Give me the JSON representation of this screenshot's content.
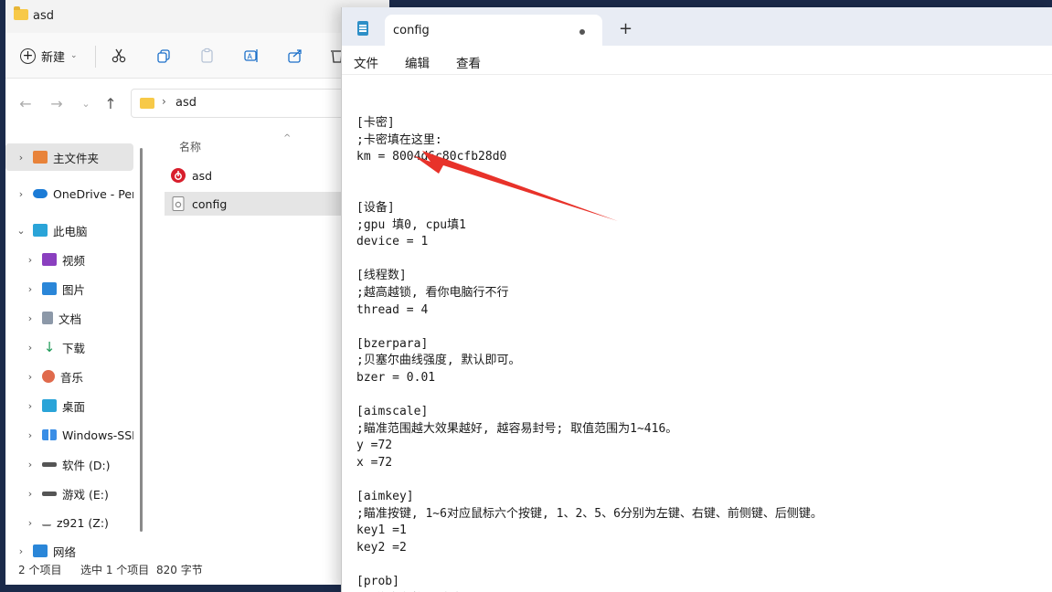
{
  "explorer": {
    "title": "asd",
    "toolbar": {
      "new_label": "新建"
    },
    "address": {
      "path": "asd"
    },
    "nav_items": [
      {
        "label": "主文件夹",
        "icon": "home-icon",
        "color": "#e8833a"
      },
      {
        "label": "OneDrive - Pers",
        "icon": "cloud-icon",
        "color": "#1b7bd6"
      },
      {
        "label": "此电脑",
        "icon": "computer-icon",
        "color": "#2aa4d8"
      },
      {
        "label": "视频",
        "icon": "video-icon",
        "color": "#8a3fbf"
      },
      {
        "label": "图片",
        "icon": "pictures-icon",
        "color": "#2a86d8"
      },
      {
        "label": "文档",
        "icon": "documents-icon",
        "color": "#8c98a8"
      },
      {
        "label": "下载",
        "icon": "download-icon",
        "color": "#1e9a58"
      },
      {
        "label": "音乐",
        "icon": "music-icon",
        "color": "#e06a4c"
      },
      {
        "label": "桌面",
        "icon": "desktop-icon",
        "color": "#2aa4d8"
      },
      {
        "label": "Windows-SSD",
        "icon": "drive-icon",
        "color": "#555555"
      },
      {
        "label": "软件 (D:)",
        "icon": "drive-icon",
        "color": "#555555"
      },
      {
        "label": "游戏 (E:)",
        "icon": "drive-icon",
        "color": "#555555"
      },
      {
        "label": "z921 (Z:)",
        "icon": "network-drive-icon",
        "color": "#888888"
      },
      {
        "label": "网络",
        "icon": "network-icon",
        "color": "#2a86d8"
      }
    ],
    "column_header": "名称",
    "files": [
      {
        "name": "asd",
        "icon": "netease-music-icon",
        "color": "#d81e2c"
      },
      {
        "name": "config",
        "icon": "config-file-icon",
        "color": "#8a8a8a"
      }
    ],
    "status": {
      "item_count": "2 个项目",
      "selection": "选中 1 个项目",
      "size": "820 字节"
    }
  },
  "notepad": {
    "tab_title": "config",
    "new_tab_label": "+",
    "menu": {
      "file": "文件",
      "edit": "编辑",
      "view": "查看"
    },
    "lines": [
      "[卡密]",
      ";卡密填在这里:",
      "km = 8004d6c80cfb28d0",
      "",
      "",
      "[设备]",
      ";gpu 填0, cpu填1",
      "device = 1",
      "",
      "[线程数]",
      ";越高越锁, 看你电脑行不行",
      "thread = 4",
      "",
      "[bzerpara]",
      ";贝塞尔曲线强度, 默认即可。",
      "bzer = 0.01",
      "",
      "[aimscale]",
      ";瞄准范围越大效果越好, 越容易封号; 取值范围为1~416。",
      "y =72",
      "x =72",
      "",
      "[aimkey]",
      ";瞄准按键, 1~6对应鼠标六个按键, 1、2、5、6分别为左键、右键、前侧键、后侧键。",
      "key1 =1",
      "key2 =2",
      "",
      "[prob]",
      ";置信度参数, 默认即可"
    ]
  },
  "annotation": {
    "color": "#e8322a"
  }
}
